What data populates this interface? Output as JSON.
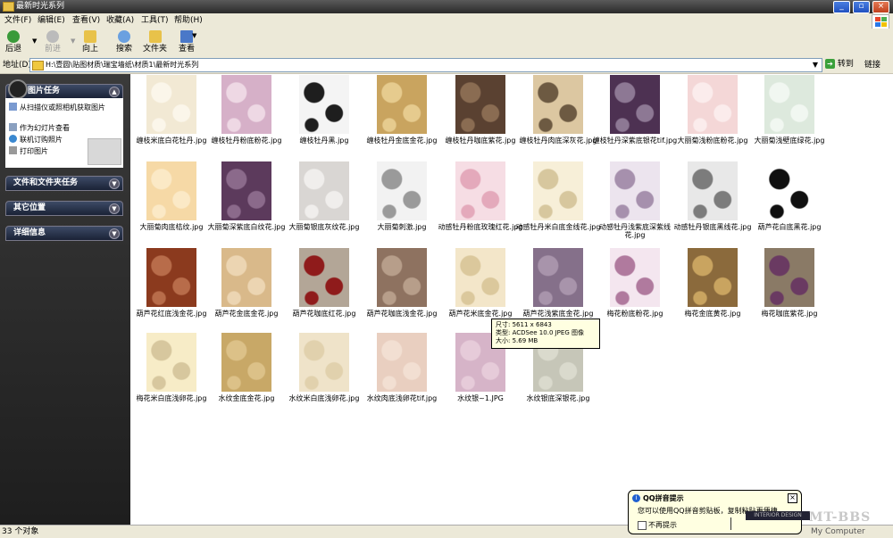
{
  "window": {
    "title": "最新时光系列"
  },
  "menu": [
    "文件(F)",
    "编辑(E)",
    "查看(V)",
    "收藏(A)",
    "工具(T)",
    "帮助(H)"
  ],
  "toolbar": {
    "back": "后退",
    "forward": "前进",
    "up": "向上",
    "search": "搜索",
    "folders": "文件夹",
    "views": "查看"
  },
  "address": {
    "label": "地址(D)",
    "path": "H:\\壹圆\\贴图材质\\瑞宝墙纸\\材质1\\最新时光系列",
    "go": "转到",
    "links": "链接"
  },
  "sidebar": {
    "picture_tasks": {
      "title": "图片任务",
      "tasks": [
        "从扫描仪或照相机获取图片",
        "作为幻灯片查看",
        "联机订购照片",
        "打印图片"
      ]
    },
    "file_folder_tasks": {
      "title": "文件和文件夹任务"
    },
    "other_places": {
      "title": "其它位置"
    },
    "details": {
      "title": "详细信息"
    }
  },
  "files": [
    {
      "name": "缠枝米底白花牡丹.jpg",
      "bg": "#f2e9d4",
      "fg": "#fbf6ea"
    },
    {
      "name": "缠枝牡丹粉底粉花.jpg",
      "bg": "#d6b0c8",
      "fg": "#eed8e4"
    },
    {
      "name": "缠枝牡丹黑.jpg",
      "bg": "#f4f4f4",
      "fg": "#1e1e1e"
    },
    {
      "name": "缠枝牡丹金底金花.jpg",
      "bg": "#c9a45f",
      "fg": "#e6cb8e"
    },
    {
      "name": "缠枝牡丹咖底紫花.jpg",
      "bg": "#5a4131",
      "fg": "#8a6c52"
    },
    {
      "name": "缠枝牡丹肉底深灰花.jpg",
      "bg": "#dcc7a1",
      "fg": "#6d5a42"
    },
    {
      "name": "缠枝牡丹深紫底银花tif.jpg",
      "bg": "#4d3152",
      "fg": "#8d7894"
    },
    {
      "name": "大丽菊浅粉底粉花.jpg",
      "bg": "#f4d7d7",
      "fg": "#fbecec"
    },
    {
      "name": "大丽菊浅壁底绿花.jpg",
      "bg": "#dde9dd",
      "fg": "#f1f7f1"
    },
    {
      "name": "大丽菊肉底桔纹.jpg",
      "bg": "#f6d9a6",
      "fg": "#fbe9c6"
    },
    {
      "name": "大丽菊深紫底白纹花.jpg",
      "bg": "#5c3a5c",
      "fg": "#8b6a8b"
    },
    {
      "name": "大丽菊银底灰纹花.jpg",
      "bg": "#d9d6d3",
      "fg": "#f0eeec"
    },
    {
      "name": "大丽菊刺激.jpg",
      "bg": "#f2f2f2",
      "fg": "#9a9a9a"
    },
    {
      "name": "动感牡丹粉底玫瑰红花.jpg",
      "bg": "#f6dde4",
      "fg": "#e4a9bb"
    },
    {
      "name": "动感牡丹米白底金线花.jpg",
      "bg": "#f7efd8",
      "fg": "#d7c79e"
    },
    {
      "name": "动感牡丹浅紫底深紫线花.jpg",
      "bg": "#ece4ee",
      "fg": "#a690ad"
    },
    {
      "name": "动感牡丹银底黑线花.jpg",
      "bg": "#e8e8e8",
      "fg": "#7c7c7c"
    },
    {
      "name": "葫芦花白底黑花.jpg",
      "bg": "#ffffff",
      "fg": "#101010"
    },
    {
      "name": "葫芦花红底浅金花.jpg",
      "bg": "#8b3a1e",
      "fg": "#b86c4a"
    },
    {
      "name": "葫芦花金底金花.jpg",
      "bg": "#d9b98a",
      "fg": "#ecd5b2"
    },
    {
      "name": "葫芦花咖底红花.jpg",
      "bg": "#b3a697",
      "fg": "#8f1b1b"
    },
    {
      "name": "葫芦花咖底浅金花.jpg",
      "bg": "#8e7260",
      "fg": "#b79e8a"
    },
    {
      "name": "葫芦花米底金花.jpg",
      "bg": "#f3e6c9",
      "fg": "#dbc89c"
    },
    {
      "name": "葫芦花浅紫底金花.jpg",
      "bg": "#85708a",
      "fg": "#a894ab"
    },
    {
      "name": "梅花粉底粉花.jpg",
      "bg": "#f4e6ef",
      "fg": "#b07a9e"
    },
    {
      "name": "梅花金底黄花.jpg",
      "bg": "#8b6a3c",
      "fg": "#c9a460"
    },
    {
      "name": "梅花咖底紫花.jpg",
      "bg": "#8a7a66",
      "fg": "#6a3a62"
    },
    {
      "name": "梅花米白底浅卵花.jpg",
      "bg": "#f7ecc7",
      "fg": "#d7c79e"
    },
    {
      "name": "水纹金底金花.jpg",
      "bg": "#c8a867",
      "fg": "#dcc188"
    },
    {
      "name": "水纹米白底浅卵花.jpg",
      "bg": "#efe3c9",
      "fg": "#e1d1ad"
    },
    {
      "name": "水纹肉底浅卵花tif.jpg",
      "bg": "#e9cfc0",
      "fg": "#f2dfd2"
    },
    {
      "name": "水纹银~1.JPG",
      "bg": "#d6b4c8",
      "fg": "#e6cbd9"
    },
    {
      "name": "水纹银底深银花.jpg",
      "bg": "#c6c6b8",
      "fg": "#dadacd"
    }
  ],
  "tooltip": {
    "line1": "尺寸: 5611 x 6843",
    "line2": "类型: ACDSee 10.0 JPEG 图像",
    "line3": "大小: 5.69 MB"
  },
  "balloon": {
    "title": "QQ拼音提示",
    "message": "您可以使用QQ拼音剪贴板，复制粘贴更便捷",
    "checkbox": "不再提示",
    "mark": "INTERIOR DESIGN"
  },
  "statusbar": {
    "count": "33 个对象",
    "zone": "My Computer",
    "watermark": "MT-BBS"
  },
  "colors": {
    "content_bg": "#ffffff",
    "chrome": "#ece9d8",
    "sidebar": "#2a2a2a"
  }
}
